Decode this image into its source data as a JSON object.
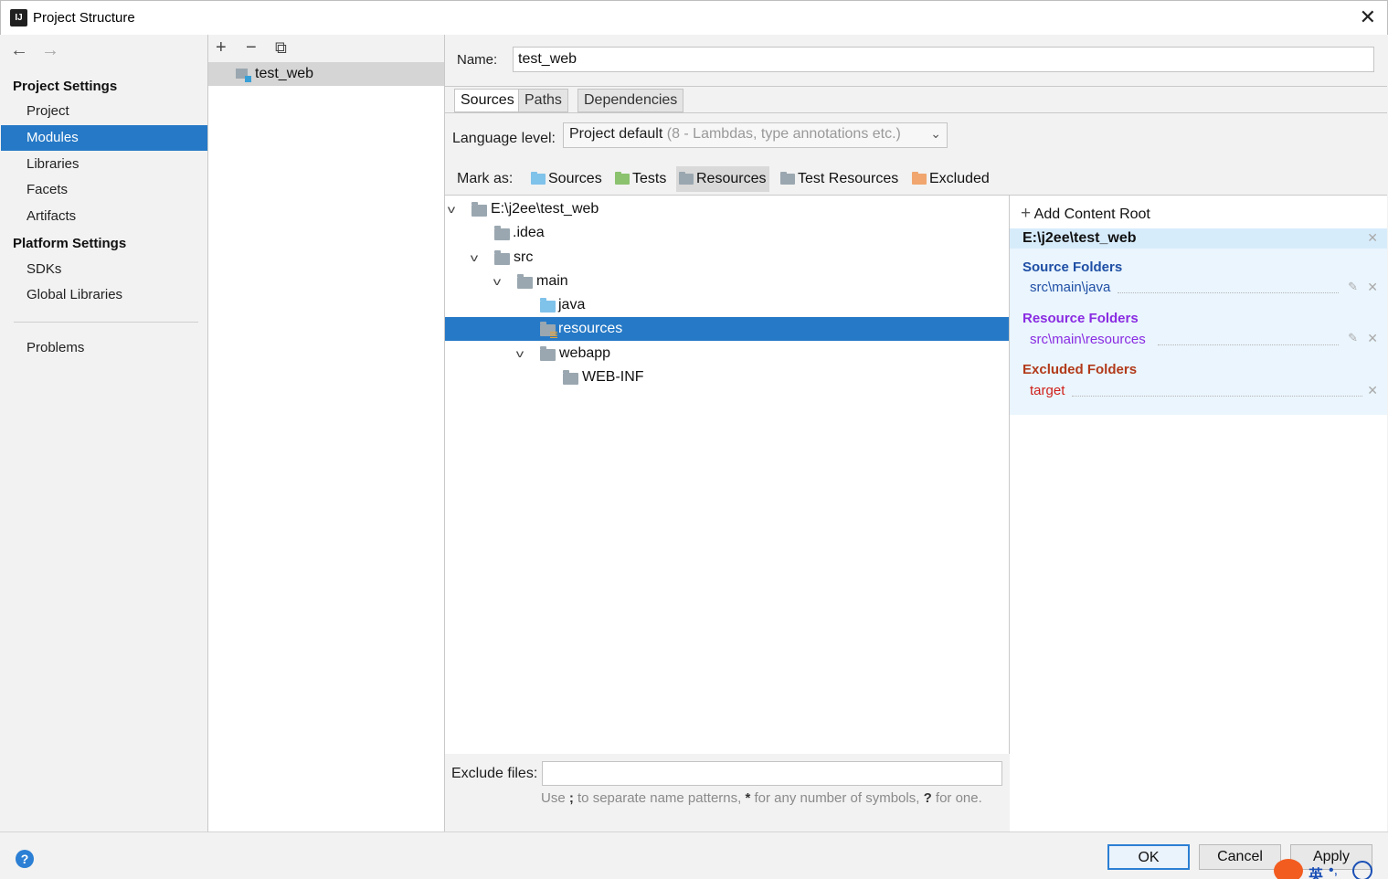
{
  "window": {
    "title": "Project Structure",
    "close_glyph": "✕"
  },
  "nav": {
    "back_glyph": "←",
    "forward_glyph": "→",
    "project_settings_heading": "Project Settings",
    "project_settings_items": [
      "Project",
      "Modules",
      "Libraries",
      "Facets",
      "Artifacts"
    ],
    "platform_settings_heading": "Platform Settings",
    "platform_settings_items": [
      "SDKs",
      "Global Libraries"
    ],
    "problems": "Problems",
    "active_item": "Modules"
  },
  "module_list": {
    "toolbar": {
      "add": "+",
      "remove": "−",
      "copy": "⧉"
    },
    "modules": [
      "test_web"
    ]
  },
  "module": {
    "name_label": "Name:",
    "name_value": "test_web",
    "tabs": [
      "Sources",
      "Paths",
      "Dependencies"
    ],
    "active_tab": "Sources",
    "language_level_label": "Language level:",
    "language_level_value": "Project default",
    "language_level_hint": "(8 - Lambdas, type annotations etc.)",
    "mark_as_label": "Mark as:",
    "mark_as": [
      {
        "label": "Sources",
        "color": "#7fc2ea"
      },
      {
        "label": "Tests",
        "color": "#8bc26e"
      },
      {
        "label": "Resources",
        "color": "#9aa7b0"
      },
      {
        "label": "Test Resources",
        "color": "#9aa7b0"
      },
      {
        "label": "Excluded",
        "color": "#f0a66e"
      }
    ],
    "active_mark": "Resources",
    "tree": [
      {
        "label": "E:\\j2ee\\test_web",
        "expanded": true,
        "depth": 0,
        "icon": "folder-icon"
      },
      {
        "label": ".idea",
        "depth": 1,
        "icon": "folder-icon"
      },
      {
        "label": "src",
        "expanded": true,
        "depth": 1,
        "icon": "folder-icon"
      },
      {
        "label": "main",
        "expanded": true,
        "depth": 2,
        "icon": "folder-icon"
      },
      {
        "label": "java",
        "depth": 3,
        "icon": "source-folder-icon"
      },
      {
        "label": "resources",
        "depth": 3,
        "icon": "resource-folder-icon",
        "selected": true
      },
      {
        "label": "webapp",
        "expanded": true,
        "depth": 3,
        "icon": "folder-icon"
      },
      {
        "label": "WEB-INF",
        "depth": 4,
        "icon": "folder-icon"
      }
    ],
    "exclude_files_label": "Exclude files:",
    "exclude_files_value": "",
    "exclude_hint_parts": [
      "Use ",
      ";",
      " to separate name patterns, ",
      "*",
      " for any number of symbols, ",
      "?",
      " for one."
    ]
  },
  "content_roots": {
    "add_root_label": "Add Content Root",
    "root_path": "E:\\j2ee\\test_web",
    "source_heading": "Source Folders",
    "source_color": "#1f4fa5",
    "source_folders": [
      "src\\main\\java"
    ],
    "resource_heading": "Resource Folders",
    "resource_color": "#8a2be2",
    "resource_folders": [
      "src\\main\\resources"
    ],
    "excluded_heading": "Excluded Folders",
    "excluded_color": "#b23a1a",
    "excluded_folders": [
      "target"
    ]
  },
  "footer": {
    "help_glyph": "?",
    "ok_label": "OK",
    "cancel_label": "Cancel",
    "apply_label": "Apply"
  },
  "ime": {
    "lang_glyph": "英",
    "punct_glyph": "•,"
  }
}
